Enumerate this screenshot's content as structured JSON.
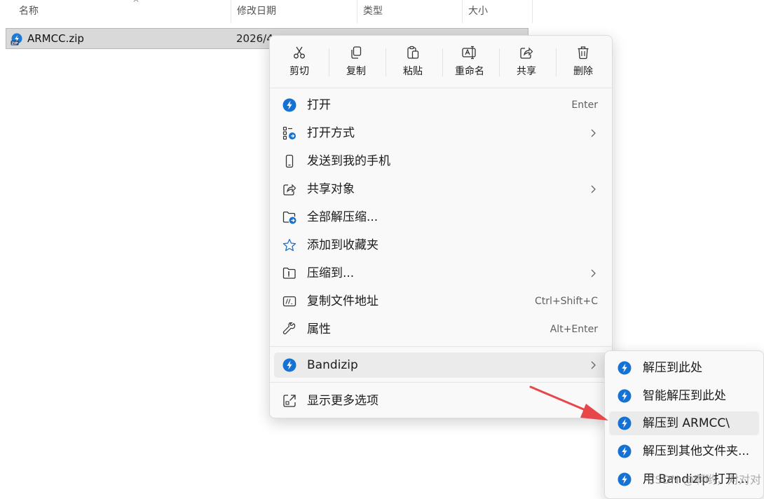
{
  "columns": {
    "name": "名称",
    "modified": "修改日期",
    "type": "类型",
    "size": "大小",
    "sort_indicator": "^"
  },
  "file": {
    "name": "ARMCC.zip",
    "modified_partial": "2026/4",
    "icon": "zip-archive-icon"
  },
  "toolbar": [
    {
      "label": "剪切",
      "icon": "scissors-icon"
    },
    {
      "label": "复制",
      "icon": "copy-icon"
    },
    {
      "label": "粘贴",
      "icon": "paste-icon"
    },
    {
      "label": "重命名",
      "icon": "rename-icon"
    },
    {
      "label": "共享",
      "icon": "share-icon"
    },
    {
      "label": "删除",
      "icon": "trash-icon"
    }
  ],
  "menu": {
    "items": [
      {
        "label": "打开",
        "shortcut": "Enter",
        "icon": "bandizip-icon"
      },
      {
        "label": "打开方式",
        "shortcut": "",
        "icon": "open-with-icon",
        "submenu": true
      },
      {
        "label": "发送到我的手机",
        "shortcut": "",
        "icon": "phone-icon"
      },
      {
        "label": "共享对象",
        "shortcut": "",
        "icon": "share-icon",
        "submenu": true
      },
      {
        "label": "全部解压缩...",
        "shortcut": "",
        "icon": "extract-folder-icon"
      },
      {
        "label": "添加到收藏夹",
        "shortcut": "",
        "icon": "star-icon"
      },
      {
        "label": "压缩到...",
        "shortcut": "",
        "icon": "compress-icon",
        "submenu": true
      },
      {
        "label": "复制文件地址",
        "shortcut": "Ctrl+Shift+C",
        "icon": "copy-path-icon"
      },
      {
        "label": "属性",
        "shortcut": "Alt+Enter",
        "icon": "wrench-icon"
      }
    ],
    "bandizip": {
      "label": "Bandizip",
      "icon": "bandizip-icon"
    },
    "more": {
      "label": "显示更多选项",
      "icon": "more-options-icon"
    }
  },
  "submenu": {
    "items": [
      {
        "label": "解压到此处"
      },
      {
        "label": "智能解压到此处"
      },
      {
        "label": "解压到 ARMCC\\"
      },
      {
        "label": "解压到其他文件夹..."
      },
      {
        "label": "用 Bandizip 打开..."
      }
    ]
  },
  "watermark": "CSDN @啊哟，对对对",
  "colors": {
    "accent": "#0067c0",
    "arrow": "#e8474a",
    "selection": "#d9d9d9",
    "hover": "#ebebeb"
  }
}
